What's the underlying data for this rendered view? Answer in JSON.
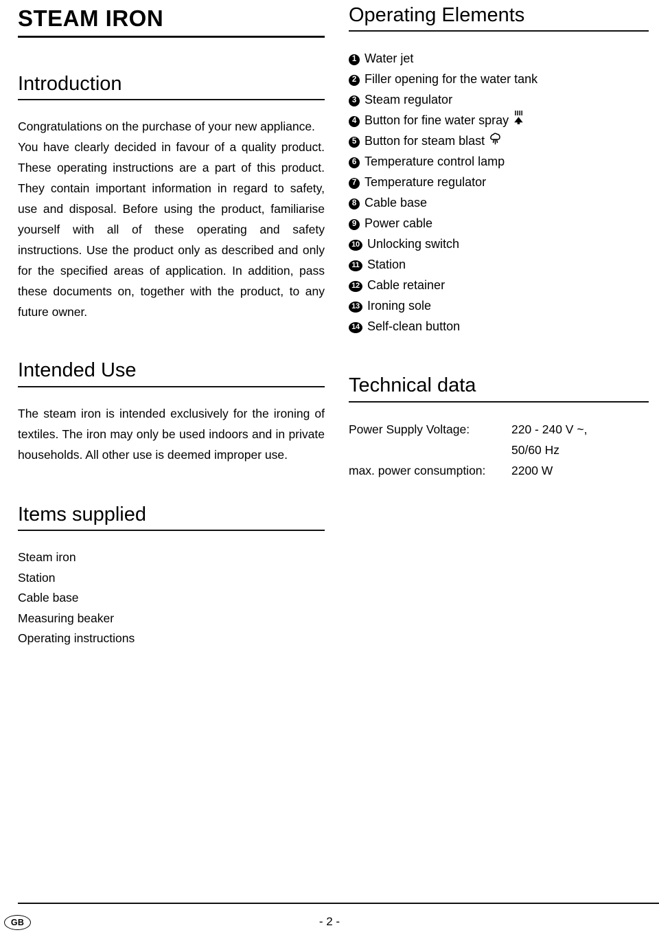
{
  "document": {
    "title": "STEAM IRON"
  },
  "left_column": {
    "introduction": {
      "heading": "Introduction",
      "paragraph_lines": [
        "Congratulations on the purchase of your new appli-",
        "ance.",
        "You have clearly decided in favour of a quality",
        "product. These operating instructions are a part of",
        "this product. They contain important information in",
        "regard to safety, use and disposal. Before using the",
        "product, familiarise yourself with all of these operating",
        "and safety instructions. Use the product only as des-",
        "cribed and only for the specified areas of application.",
        "In addition, pass these documents on, together with",
        "the product, to any future owner."
      ],
      "paragraph_1": "Congratulations on the purchase of your new appliance.",
      "paragraph_2": "You have clearly decided in favour of a quality product. These operating instructions are a part of this product. They contain important information in regard to safety, use and disposal. Before using the product, familiarise yourself with all of these operating and safety instructions. Use the product only as described and only for the specified areas of application. In addition, pass these documents on, together with the product, to any future owner."
    },
    "intended_use": {
      "heading": "Intended Use",
      "paragraph": "The steam iron is intended exclusively for the ironing of textiles. The iron may only be used indoors and in private households. All other use is deemed improper use."
    },
    "items_supplied": {
      "heading": "Items supplied",
      "items": [
        "Steam iron",
        "Station",
        "Cable base",
        "Measuring beaker",
        "Operating instructions"
      ]
    }
  },
  "right_column": {
    "operating_elements": {
      "heading": "Operating Elements",
      "items": [
        {
          "number": "1",
          "label": "Water jet",
          "icon": ""
        },
        {
          "number": "2",
          "label": "Filler opening for the water tank",
          "icon": ""
        },
        {
          "number": "3",
          "label": "Steam regulator",
          "icon": ""
        },
        {
          "number": "4",
          "label": "Button for fine water spray",
          "icon": "water-spray-icon"
        },
        {
          "number": "5",
          "label": "Button for steam blast",
          "icon": "steam-blast-icon"
        },
        {
          "number": "6",
          "label": "Temperature control lamp",
          "icon": ""
        },
        {
          "number": "7",
          "label": "Temperature regulator",
          "icon": ""
        },
        {
          "number": "8",
          "label": "Cable base",
          "icon": ""
        },
        {
          "number": "9",
          "label": "Power cable",
          "icon": ""
        },
        {
          "number": "10",
          "label": "Unlocking switch",
          "icon": ""
        },
        {
          "number": "11",
          "label": "Station",
          "icon": ""
        },
        {
          "number": "12",
          "label": "Cable retainer",
          "icon": ""
        },
        {
          "number": "13",
          "label": "Ironing sole",
          "icon": ""
        },
        {
          "number": "14",
          "label": "Self-clean button",
          "icon": ""
        }
      ]
    },
    "technical_data": {
      "heading": "Technical data",
      "rows": [
        {
          "label": "Power Supply Voltage:",
          "value": "220 - 240 V ~,"
        },
        {
          "label": "",
          "value": "50/60 Hz"
        },
        {
          "label": "max. power consumption:",
          "value": "2200 W"
        }
      ]
    }
  },
  "footer": {
    "language_badge": "GB",
    "page_number": "- 2 -"
  },
  "colors": {
    "text": "#000000",
    "rule": "#111111",
    "background": "#ffffff"
  }
}
